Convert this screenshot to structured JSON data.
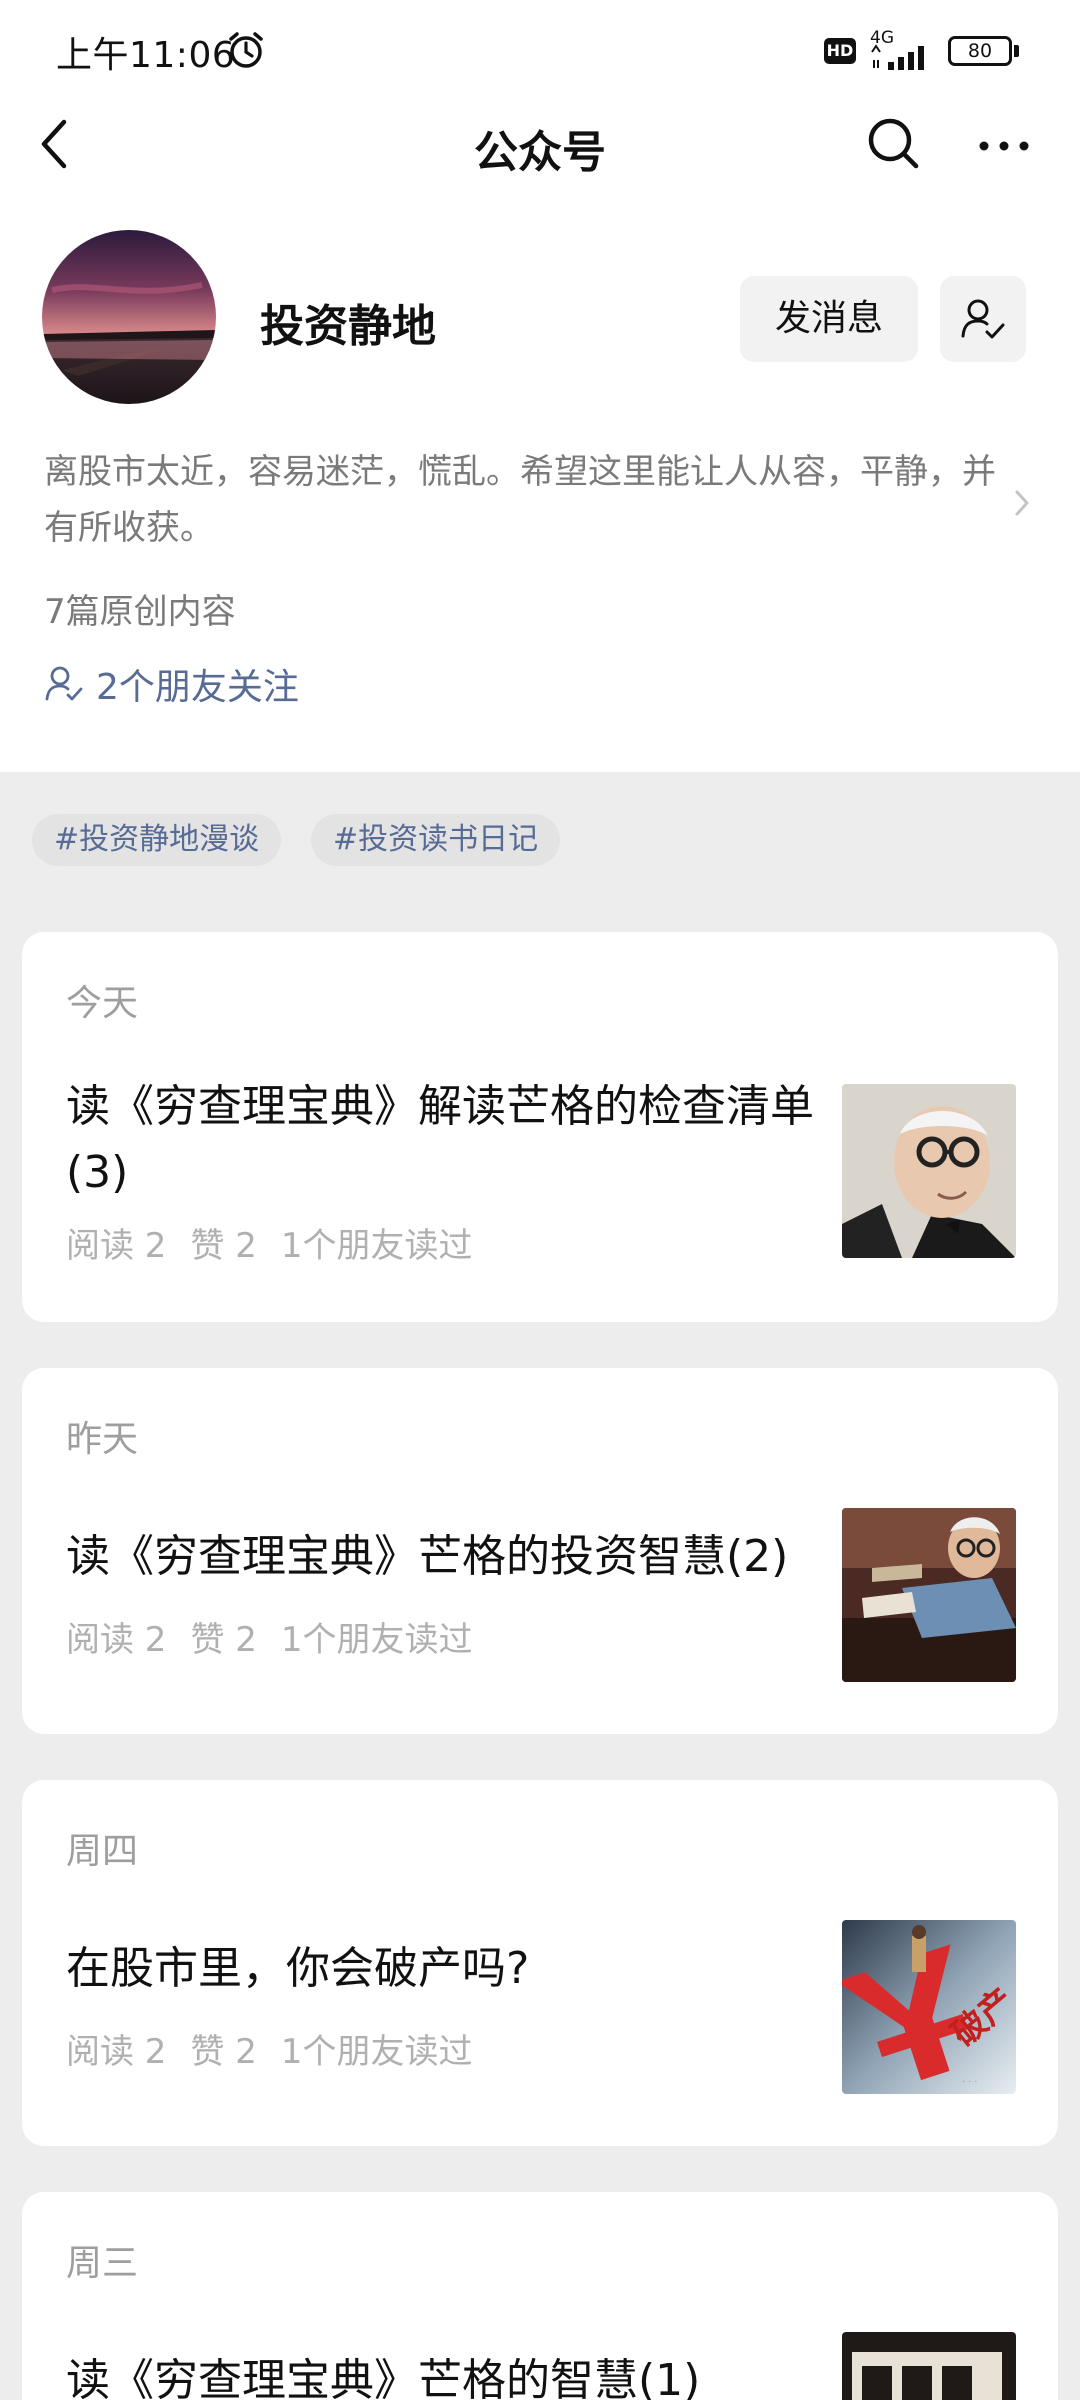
{
  "status_bar": {
    "time": "上午11:06",
    "hd": "HD",
    "network": "4G",
    "battery": "80"
  },
  "nav": {
    "title": "公众号"
  },
  "account": {
    "name": "投资静地",
    "message_button": "发消息",
    "intro": "离股市太近，容易迷茫，慌乱。希望这里能让人从容，平静，并有所收获。",
    "original_count": "7篇原创内容",
    "friends_following": "2个朋友关注"
  },
  "tags": [
    "#投资静地漫谈",
    "#投资读书日记"
  ],
  "articles": [
    {
      "date": "今天",
      "title": "读《穷查理宝典》解读芒格的检查清单(3)",
      "reads": "阅读 2",
      "likes": "赞 2",
      "friends": "1个朋友读过"
    },
    {
      "date": "昨天",
      "title": "读《穷查理宝典》芒格的投资智慧(2)",
      "reads": "阅读 2",
      "likes": "赞 2",
      "friends": "1个朋友读过"
    },
    {
      "date": "周四",
      "title": "在股市里，你会破产吗?",
      "reads": "阅读 2",
      "likes": "赞 2",
      "friends": "1个朋友读过",
      "thumb_text": "破产"
    },
    {
      "date": "周三",
      "title": "读《穷查理宝典》芒格的智慧(1)"
    }
  ],
  "colors": {
    "link_blue": "#576b95",
    "page_background": "#ededed",
    "muted_text": "#9e9e9e"
  }
}
